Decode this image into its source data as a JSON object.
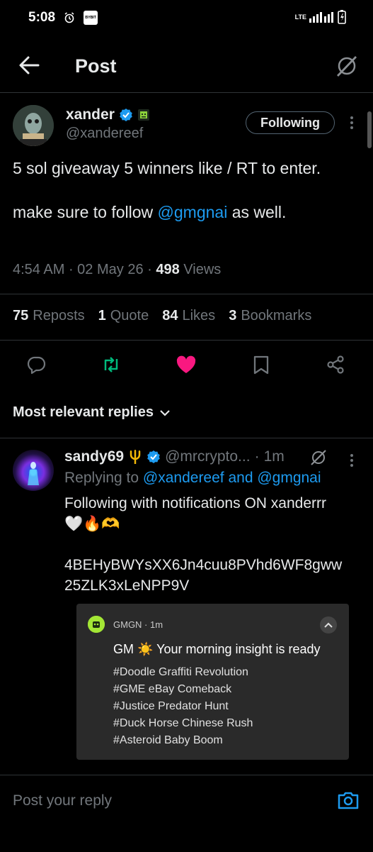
{
  "status_bar": {
    "time": "5:08",
    "bybit_label": "BYBIT",
    "network": "LTE"
  },
  "header": {
    "title": "Post"
  },
  "post": {
    "author_name": "xander",
    "author_handle": "@xandereef",
    "follow_label": "Following",
    "text_line1": "5 sol giveaway 5 winners like / RT to enter.",
    "text_line2_prefix": "make sure to follow ",
    "text_mention": "@gmgnai",
    "text_line2_suffix": " as well.",
    "time": "4:54 AM",
    "date": "02 May 26",
    "views_count": "498",
    "views_label": "Views",
    "reposts_count": "75",
    "reposts_label": "Reposts",
    "quotes_count": "1",
    "quotes_label": "Quote",
    "likes_count": "84",
    "likes_label": "Likes",
    "bookmarks_count": "3",
    "bookmarks_label": "Bookmarks"
  },
  "replies": {
    "sort_label": "Most relevant replies",
    "items": [
      {
        "author_name": "sandy69",
        "author_handle": "@mrcrypto...",
        "time": "1m",
        "replying_prefix": "Replying to",
        "replying_users": "@xandereef and @gmgnai",
        "line1": "Following with notifications ON xanderrr",
        "emojis": "🤍🔥🫶",
        "line2": "4BEHyBWYsXX6Jn4cuu8PVhd6WF8gww",
        "line3": "25ZLK3xLeNPP9V",
        "image": {
          "app": "GMGN · 1m",
          "title": "GM ☀️ Your morning insight is ready",
          "lines": [
            "#Doodle Graffiti Revolution",
            "#GME eBay Comeback",
            "#Justice Predator Hunt",
            "#Duck Horse Chinese Rush",
            "#Asteroid Baby Boom"
          ]
        }
      }
    ]
  },
  "reply_bar": {
    "placeholder": "Post your reply"
  },
  "colors": {
    "accent": "#1d9bf0",
    "like": "#f91880",
    "repost": "#00ba7c",
    "muted": "#71767b"
  }
}
